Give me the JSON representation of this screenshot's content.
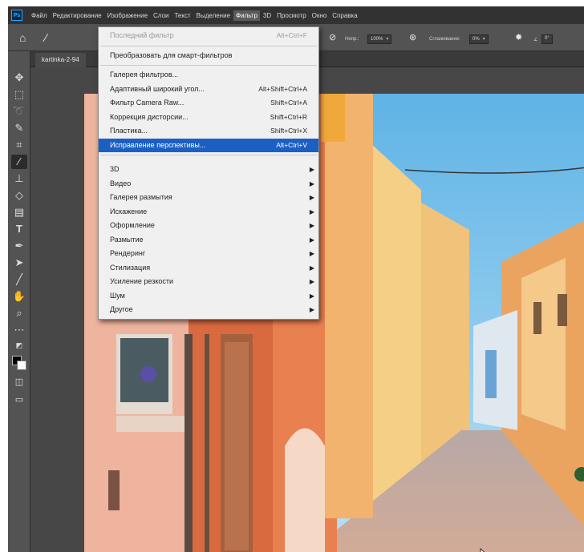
{
  "menubar": {
    "logo": "Ps",
    "items": [
      "Файл",
      "Редактирование",
      "Изображение",
      "Слои",
      "Текст",
      "Выделение",
      "Фильтр",
      "3D",
      "Просмотр",
      "Окно",
      "Справка"
    ]
  },
  "options": {
    "opacity_label": "Непр.:",
    "opacity_value": "100%",
    "smoothing_label": "Сглаживание:",
    "smoothing_value": "0%",
    "angle_value": "0°"
  },
  "document_tab": "kartinka-2-94",
  "filter_menu": {
    "groups": [
      [
        {
          "label": "Последний фильтр",
          "shortcut": "Alt+Ctrl+F",
          "disabled": true
        }
      ],
      [
        {
          "label": "Преобразовать для смарт-фильтров",
          "shortcut": ""
        }
      ],
      [
        {
          "label": "Галерея фильтров...",
          "shortcut": ""
        },
        {
          "label": "Адаптивный широкий угол...",
          "shortcut": "Alt+Shift+Ctrl+A"
        },
        {
          "label": "Фильтр Camera Raw...",
          "shortcut": "Shift+Ctrl+A"
        },
        {
          "label": "Коррекция дисторсии...",
          "shortcut": "Shift+Ctrl+R"
        },
        {
          "label": "Пластика...",
          "shortcut": "Shift+Ctrl+X"
        },
        {
          "label": "Исправление перспективы...",
          "shortcut": "Alt+Ctrl+V",
          "highlighted": true
        }
      ],
      [
        {
          "label": "3D",
          "submenu": true
        },
        {
          "label": "Видео",
          "submenu": true
        },
        {
          "label": "Галерея размытия",
          "submenu": true
        },
        {
          "label": "Искажение",
          "submenu": true
        },
        {
          "label": "Оформление",
          "submenu": true
        },
        {
          "label": "Размытие",
          "submenu": true
        },
        {
          "label": "Рендеринг",
          "submenu": true
        },
        {
          "label": "Стилизация",
          "submenu": true
        },
        {
          "label": "Усиление резкости",
          "submenu": true
        },
        {
          "label": "Шум",
          "submenu": true
        },
        {
          "label": "Другое",
          "submenu": true
        }
      ]
    ]
  },
  "colors": {
    "highlight": "#1c5fc3",
    "sky": "#7fc6ec",
    "orange_wall": "#e8744a",
    "pink_wall": "#f0b9a4",
    "yellow_wall": "#f1c56e",
    "street": "#c9a693"
  }
}
